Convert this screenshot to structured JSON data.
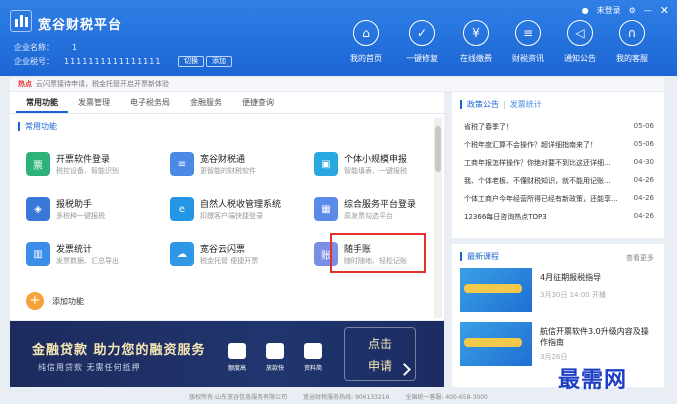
{
  "header": {
    "title": "宽谷财税平台",
    "company_name_label": "企业名称：",
    "company_name": "1",
    "tax_id_label": "企业税号：",
    "tax_id": "1111111111111111",
    "switch_btn": "切换",
    "add_btn": "添加",
    "login_text": "未登录",
    "nav": [
      {
        "label": "我的首页",
        "icon": "home-icon",
        "glyph": "⌂"
      },
      {
        "label": "一键修复",
        "icon": "repair-icon",
        "glyph": "✓"
      },
      {
        "label": "在线缴费",
        "icon": "yen-icon",
        "glyph": "¥"
      },
      {
        "label": "财税资讯",
        "icon": "news-icon",
        "glyph": "≡"
      },
      {
        "label": "通知公告",
        "icon": "speaker-icon",
        "glyph": "◁"
      },
      {
        "label": "我的客服",
        "icon": "headset-icon",
        "glyph": "∩"
      }
    ]
  },
  "notice": {
    "tag": "热点",
    "text": "云闪票接待申请，税金托管开启开票新体验"
  },
  "tabs": [
    "常用功能",
    "发票管理",
    "电子税务局",
    "金融服务",
    "便捷查询"
  ],
  "section_title": "常用功能",
  "tiles": [
    {
      "title": "开票软件登录",
      "sub": "税控设备、智能识别",
      "color": "#2db37a",
      "glyph": "票"
    },
    {
      "title": "宽谷财税通",
      "sub": "更智能的财税软件",
      "color": "#4b8ae4",
      "glyph": "≡"
    },
    {
      "title": "个体小规模申报",
      "sub": "智能填表、一键报税",
      "color": "#28a7e0",
      "glyph": "▣"
    },
    {
      "title": "报税助手",
      "sub": "多税种一键报税",
      "color": "#3a78d8",
      "glyph": "◈"
    },
    {
      "title": "自然人税收管理系统",
      "sub": "扣缴客户端快捷登录",
      "color": "#2596e3",
      "glyph": "e"
    },
    {
      "title": "综合服务平台登录",
      "sub": "原发票勾选平台",
      "color": "#5a8be8",
      "glyph": "▦"
    },
    {
      "title": "发票统计",
      "sub": "发票数据、汇总导出",
      "color": "#3b8ee8",
      "glyph": "▥"
    },
    {
      "title": "宽谷云闪票",
      "sub": "税金托管 便捷开票",
      "color": "#2e97e6",
      "glyph": "☁"
    },
    {
      "title": "随手账",
      "sub": "随时随地、轻松记账",
      "color": "#7b8ee6",
      "glyph": "账"
    }
  ],
  "add_label": "添加功能",
  "banner": {
    "headline": "金融贷款 助力您的融资服务",
    "sub": "纯信用贷款 无需任何抵押",
    "items": [
      "额度高",
      "放款快",
      "资料简"
    ],
    "cta": [
      "点击",
      "申请"
    ]
  },
  "notices_panel": {
    "tab_active": "政策公告",
    "tab_other": "发票统计",
    "items": [
      {
        "text": "省税了春季了！",
        "date": "05-06"
      },
      {
        "text": "个税年度汇算不会操作？超详细指南来了！",
        "date": "05-06"
      },
      {
        "text": "工商年报怎样操作？你绝对要不到比这还详细...",
        "date": "04-30"
      },
      {
        "text": "我、个体老板、不懂财税知识，就不能用记账...",
        "date": "04-26"
      },
      {
        "text": "个体工商户今年经营所得已经有新政策，还能享...",
        "date": "04-26"
      },
      {
        "text": "12366每日咨询热点TOP3",
        "date": "04-26"
      }
    ]
  },
  "courses_panel": {
    "title": "最新课程",
    "more": "查看更多",
    "items": [
      {
        "title": "4月征期报税指导",
        "sub": "3月30日 14:00 开播"
      },
      {
        "title": "航信开票软件3.0升级内容及操作指南",
        "sub": "3月26日"
      }
    ]
  },
  "footer": [
    "版权所有:山东宽谷信息服务有限公司",
    "宽谷财税服务热线: 906133216",
    "全国统一客服: 400-658-3000"
  ],
  "watermark": "最需网"
}
